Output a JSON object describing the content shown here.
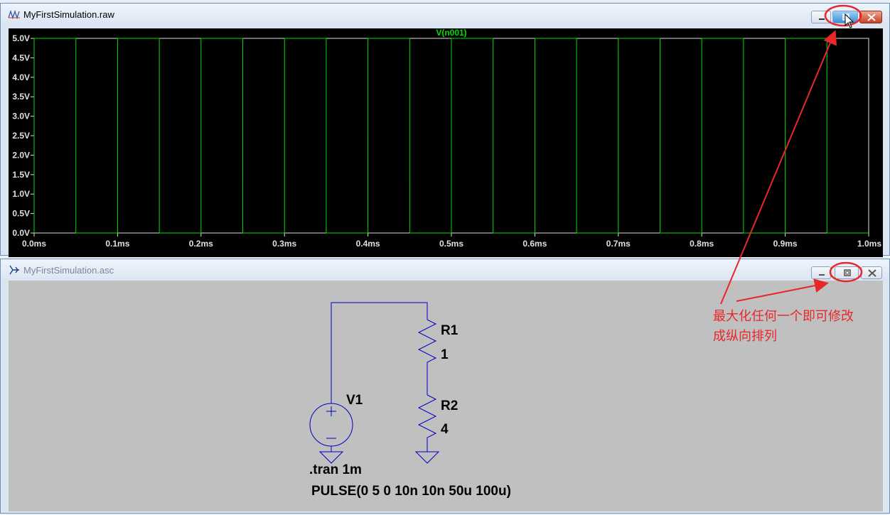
{
  "waveform_window": {
    "title": "MyFirstSimulation.raw",
    "trace_label": "V(n001)",
    "trace_color": "#00e000",
    "y_ticks": [
      "5.0V",
      "4.5V",
      "4.0V",
      "3.5V",
      "3.0V",
      "2.5V",
      "2.0V",
      "1.5V",
      "1.0V",
      "0.5V",
      "0.0V"
    ],
    "x_ticks": [
      "0.0ms",
      "0.1ms",
      "0.2ms",
      "0.3ms",
      "0.4ms",
      "0.5ms",
      "0.6ms",
      "0.7ms",
      "0.8ms",
      "0.9ms",
      "1.0ms"
    ]
  },
  "chart_data": {
    "type": "line",
    "series": [
      {
        "name": "V(n001)",
        "pulse": {
          "low": 0,
          "high": 5,
          "delay_ms": 0,
          "rise_ms": 1e-05,
          "fall_ms": 1e-05,
          "width_ms": 0.05,
          "period_ms": 0.1
        }
      }
    ],
    "xlim": [
      0,
      1.0
    ],
    "ylim": [
      0,
      5.0
    ],
    "grid": false
  },
  "schematic_window": {
    "title": "MyFirstSimulation.asc",
    "wire_color": "#0000c0",
    "components": {
      "r1_name": "R1",
      "r1_value": "1",
      "r2_name": "R2",
      "r2_value": "4",
      "v1_name": "V1"
    },
    "directive": ".tran 1m",
    "source_value": "PULSE(0 5 0 10n 10n 50u 100u)"
  },
  "annotation": {
    "line1": "最大化任何一个即可修改",
    "line2": "成纵向排列",
    "color": "#e8272b"
  }
}
